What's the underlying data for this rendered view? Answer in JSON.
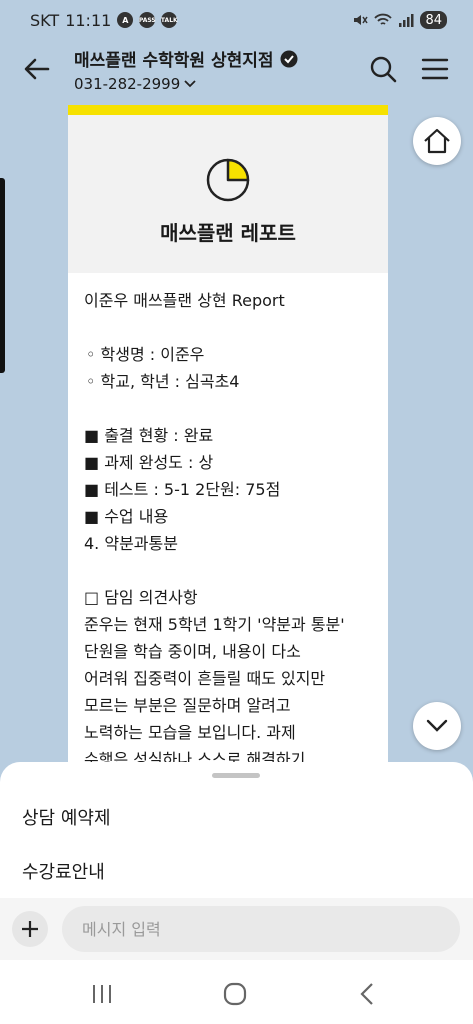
{
  "status_bar": {
    "carrier": "SKT",
    "time": "11:11",
    "app_icons": [
      "A",
      "PASS",
      "TALK"
    ],
    "battery": "84"
  },
  "header": {
    "title": "매쓰플랜 수학학원 상현지점",
    "phone": "031-282-2999",
    "icons": [
      "back-arrow-icon",
      "verified-badge-icon",
      "chevron-down-icon",
      "search-icon",
      "menu-icon"
    ]
  },
  "card": {
    "report_title": "매쓰플랜 레포트",
    "accent": "#f6e100",
    "line1": "이준우 매쓰플랜 상현 Report",
    "student_name": "◦  학생명 : 이준우",
    "school_grade": "◦  학교, 학년 : 심곡초4",
    "attendance": "■ 출결 현황 : 완료",
    "homework": "■ 과제 완성도 : 상",
    "test": "■ 테스트 : 5-1 2단원: 75점",
    "class_content": "■ 수업 내용",
    "class_topic": "4. 약분과통분",
    "opinion_header": "□ 담임 의견사항",
    "opinion_lines": [
      "준우는 현재 5학년 1학기 '약분과 통분'",
      "단원을 학습 중이며, 내용이 다소",
      "어려워 집중력이 흔들릴 때도 있지만",
      "모르는 부분은 질문하며 알려고",
      "노력하는 모습을 보입니다. 과제",
      "수행은 성실하나 스스로 해결하기"
    ]
  },
  "sheet": {
    "menu_items": [
      "상담 예약제",
      "수강료안내"
    ],
    "input_placeholder": "메시지 입력"
  },
  "nav": {
    "icons": [
      "recent-apps-icon",
      "home-nav-icon",
      "back-nav-icon"
    ]
  }
}
